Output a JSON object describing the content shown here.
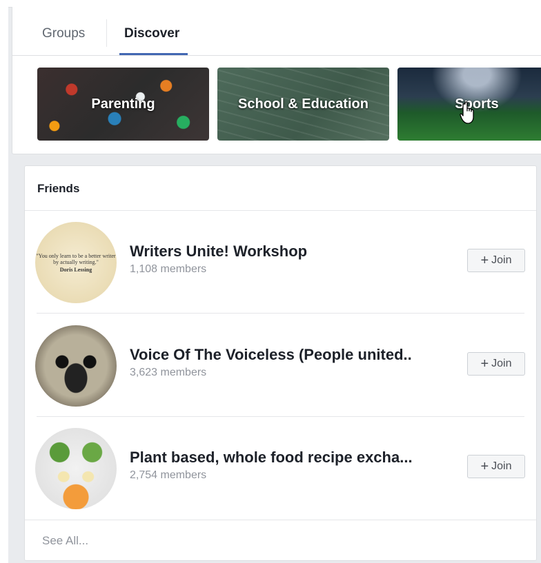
{
  "tabs": [
    {
      "label": "Groups",
      "active": false
    },
    {
      "label": "Discover",
      "active": true
    }
  ],
  "categories": [
    {
      "label": "Parenting"
    },
    {
      "label": "School & Education"
    },
    {
      "label": "Sports"
    }
  ],
  "friends": {
    "title": "Friends",
    "groups": [
      {
        "name": "Writers Unite! Workshop",
        "members": "1,108 members",
        "join_label": "Join",
        "avatar_quote": "\"You only learn to be a better writer by actually writing.\"",
        "avatar_author": "Doris Lessing"
      },
      {
        "name": "Voice Of The Voiceless (People united..",
        "members": "3,623 members",
        "join_label": "Join"
      },
      {
        "name": "Plant based, whole food recipe excha...",
        "members": "2,754 members",
        "join_label": "Join"
      }
    ],
    "see_all": "See All..."
  },
  "colors": {
    "accent": "#4267b2",
    "background": "#e9ebee",
    "muted_text": "#90949c"
  }
}
